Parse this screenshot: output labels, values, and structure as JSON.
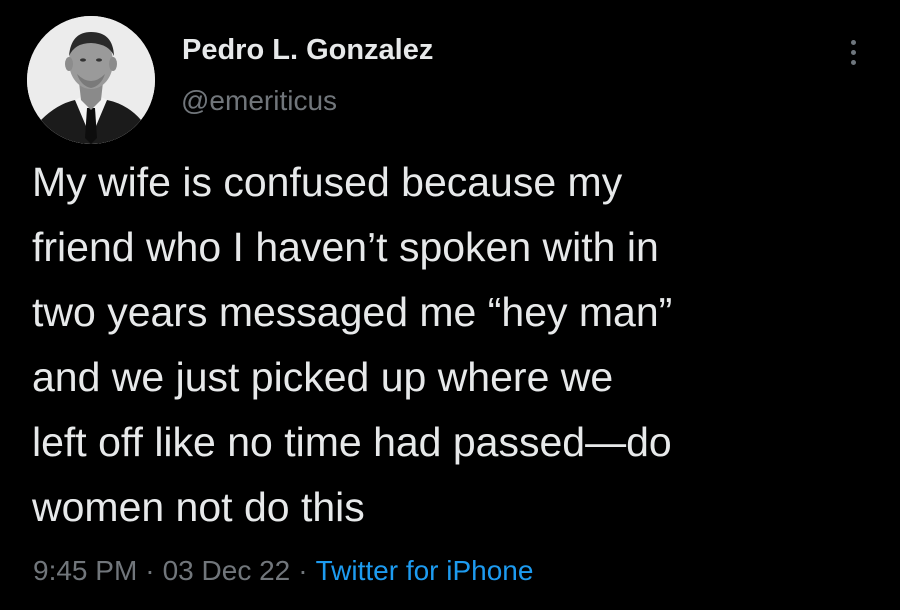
{
  "user": {
    "display_name": "Pedro L. Gonzalez",
    "handle": "@emeriticus"
  },
  "tweet": {
    "lines": [
      "My wife is confused because my",
      "friend who I haven’t spoken with in",
      "two years messaged me “hey man”",
      "and we just picked up where we",
      "left off like no time had passed—do",
      "women not do this"
    ]
  },
  "meta": {
    "time": "9:45 PM",
    "separator": "·",
    "date": "03 Dec 22",
    "source": "Twitter for iPhone"
  },
  "icons": {
    "more": "more-options-icon"
  },
  "colors": {
    "background": "#000000",
    "text": "#e7e9ea",
    "secondary": "#71767b",
    "link": "#1d9bf0"
  }
}
